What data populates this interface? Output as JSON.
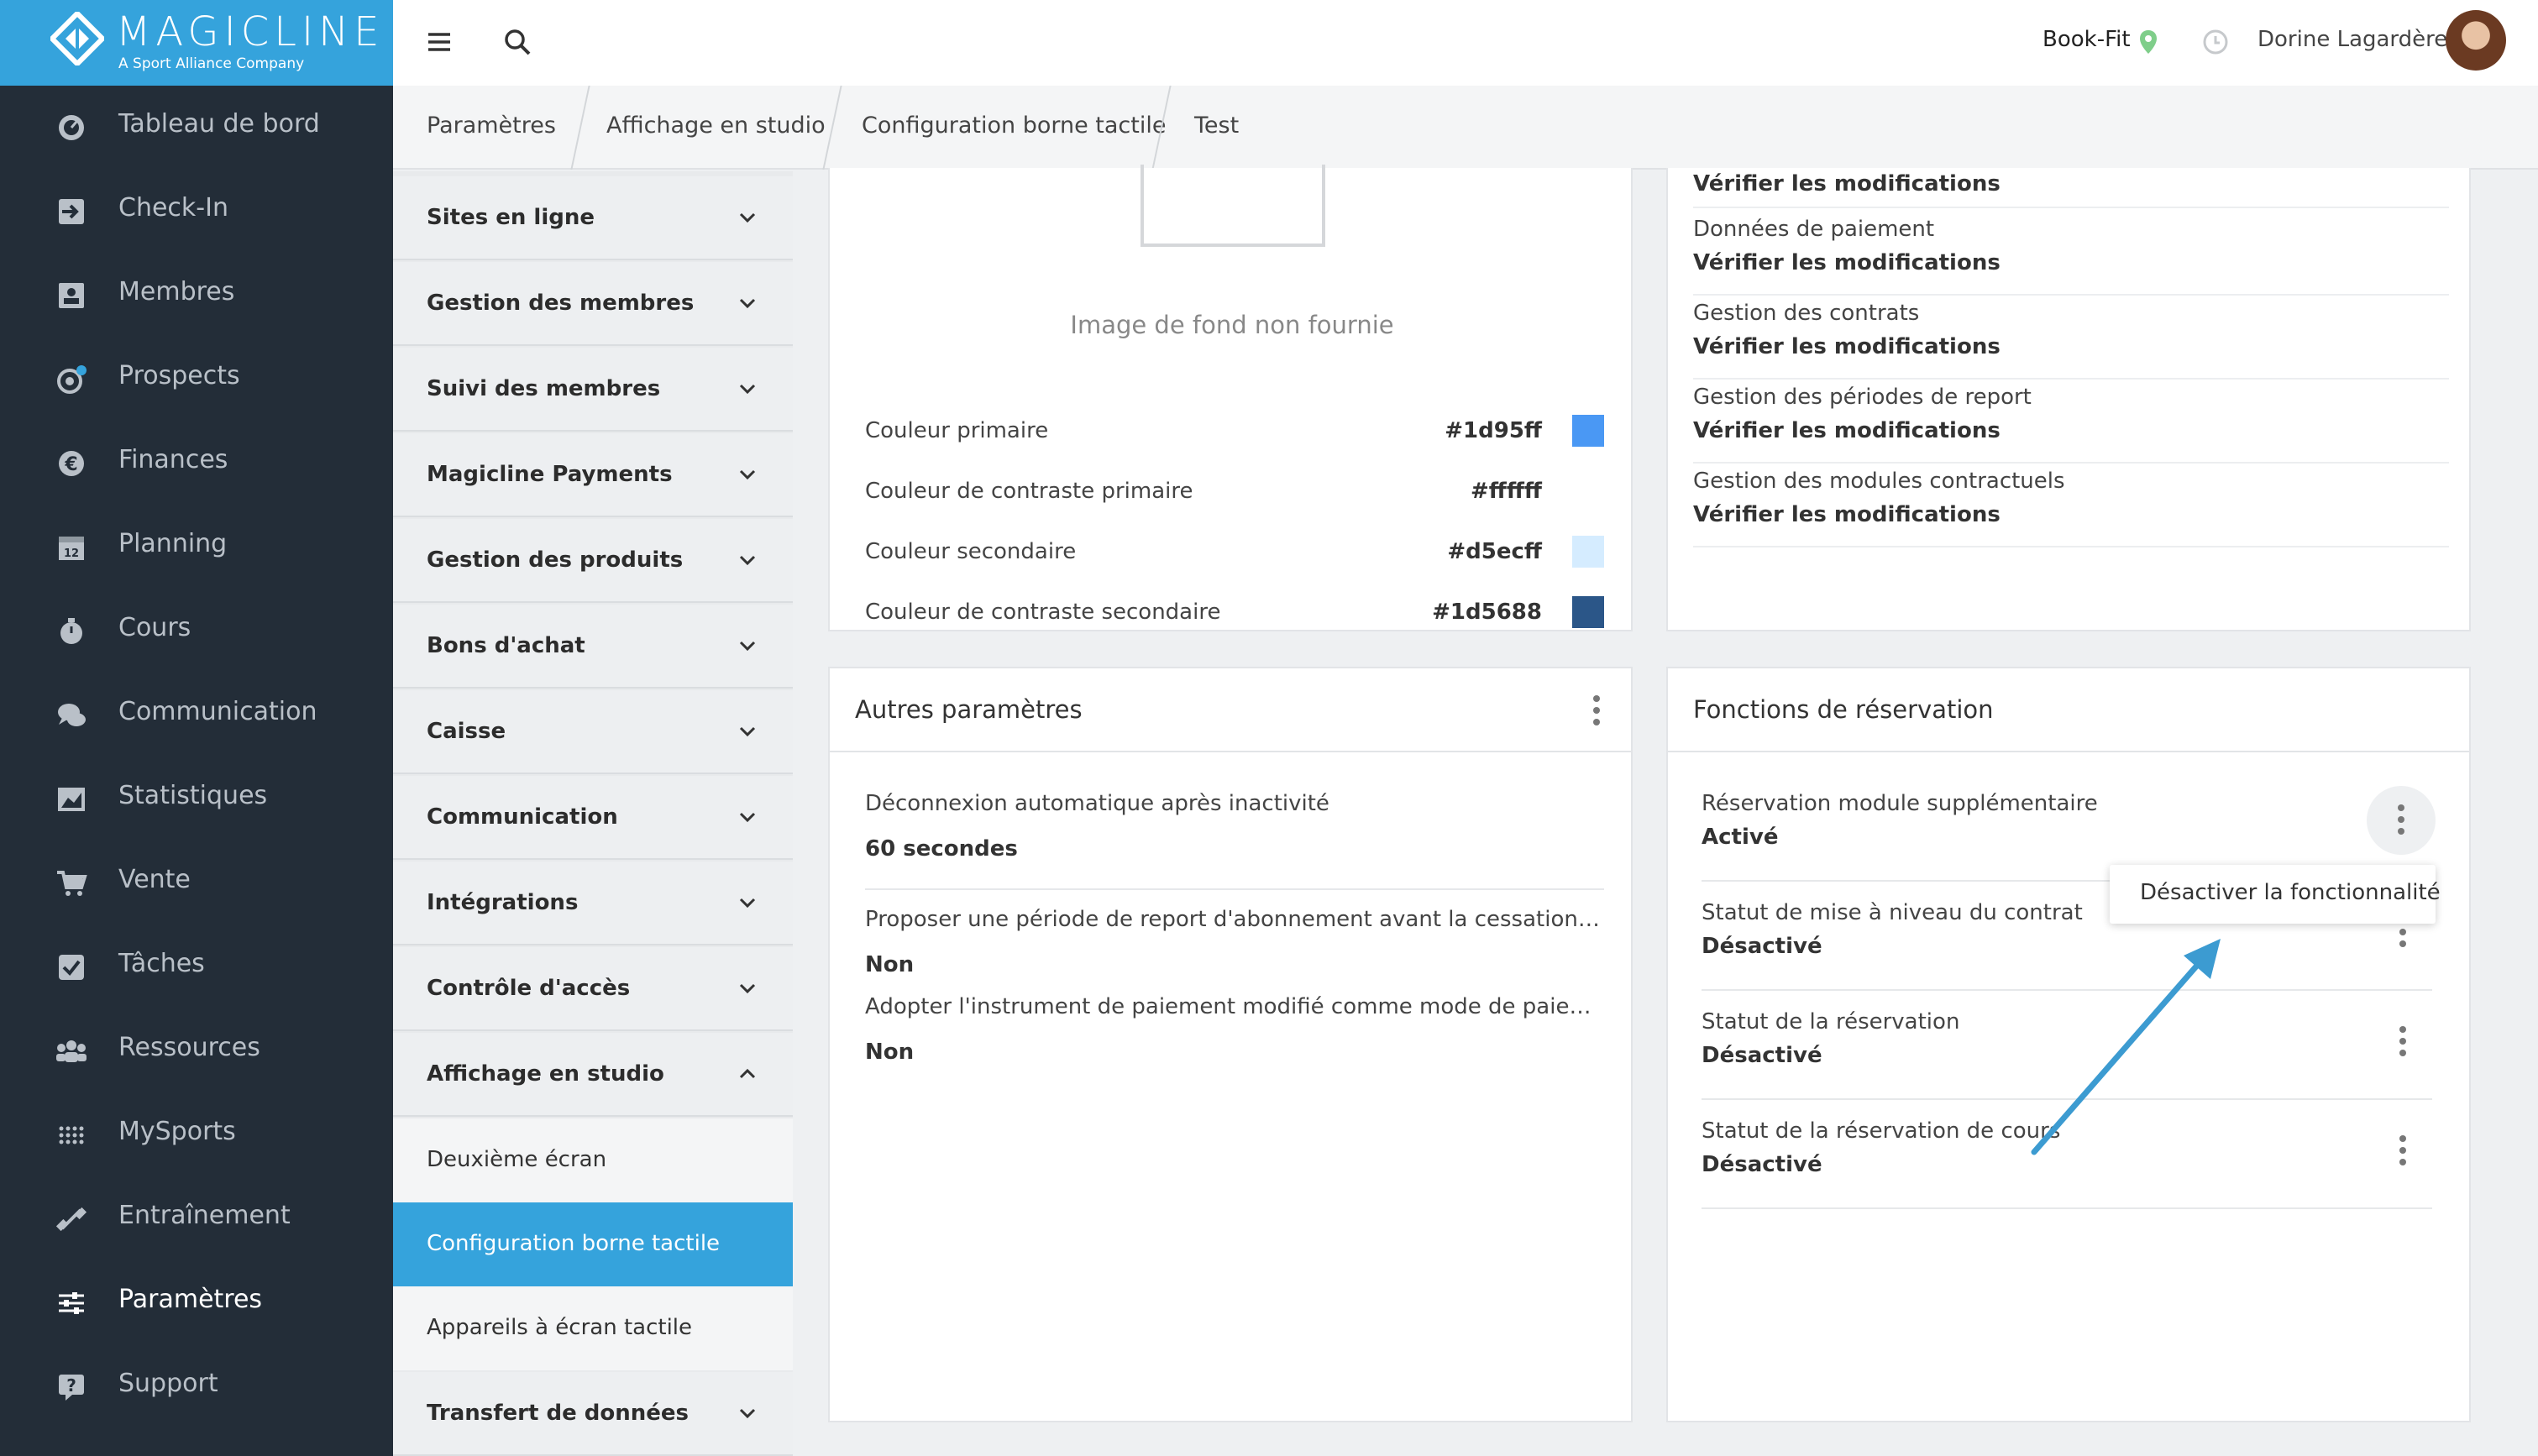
{
  "brand": {
    "name": "MAGICLINE",
    "tagline": "A Sport Alliance Company"
  },
  "nav": [
    {
      "label": "Tableau de bord",
      "icon": "dashboard-icon"
    },
    {
      "label": "Check-In",
      "icon": "check-in-icon"
    },
    {
      "label": "Membres",
      "icon": "members-icon"
    },
    {
      "label": "Prospects",
      "icon": "prospects-icon"
    },
    {
      "label": "Finances",
      "icon": "euro-icon"
    },
    {
      "label": "Planning",
      "icon": "calendar-icon"
    },
    {
      "label": "Cours",
      "icon": "stopwatch-icon"
    },
    {
      "label": "Communication",
      "icon": "chat-icon"
    },
    {
      "label": "Statistiques",
      "icon": "chart-icon"
    },
    {
      "label": "Vente",
      "icon": "cart-icon"
    },
    {
      "label": "Tâches",
      "icon": "checkbox-icon"
    },
    {
      "label": "Ressources",
      "icon": "people-icon"
    },
    {
      "label": "MySports",
      "icon": "dots-grid-icon"
    },
    {
      "label": "Entraînement",
      "icon": "dumbbell-icon"
    },
    {
      "label": "Paramètres",
      "icon": "sliders-icon"
    },
    {
      "label": "Support",
      "icon": "help-icon"
    }
  ],
  "topbar": {
    "studio": "Book-Fit",
    "user": "Dorine Lagardère"
  },
  "breadcrumb": [
    "Paramètres",
    "Affichage en studio",
    "Configuration borne tactile",
    "Test"
  ],
  "submenu": {
    "sections": [
      "Sites en ligne",
      "Gestion des membres",
      "Suivi des membres",
      "Magicline Payments",
      "Gestion des produits",
      "Bons d'achat",
      "Caisse",
      "Communication",
      "Intégrations",
      "Contrôle d'accès",
      "Affichage en studio"
    ],
    "children": [
      "Deuxième écran",
      "Configuration borne tactile",
      "Appareils à écran tactile"
    ],
    "last": "Transfert de données"
  },
  "colors": {
    "image_missing": "Image de fond non fournie",
    "rows": [
      {
        "name": "Couleur primaire",
        "hex": "#1d95ff",
        "swatch": "#4a98f4"
      },
      {
        "name": "Couleur de contraste primaire",
        "hex": "#ffffff",
        "swatch": "#ffffff"
      },
      {
        "name": "Couleur secondaire",
        "hex": "#d5ecff",
        "swatch": "#d5ecff"
      },
      {
        "name": "Couleur de contraste secondaire",
        "hex": "#1d5688",
        "swatch": "#2b5688"
      }
    ]
  },
  "verify": {
    "top_value": "Vérifier les modifications",
    "rows": [
      {
        "name": "Données de paiement",
        "value": "Vérifier les modifications"
      },
      {
        "name": "Gestion des contrats",
        "value": "Vérifier les modifications"
      },
      {
        "name": "Gestion des périodes de report",
        "value": "Vérifier les modifications"
      },
      {
        "name": "Gestion des modules contractuels",
        "value": "Vérifier les modifications"
      }
    ]
  },
  "other": {
    "title": "Autres paramètres",
    "rows": [
      {
        "name": "Déconnexion automatique après inactivité",
        "value": "60 secondes"
      },
      {
        "name": "Proposer une période de report d'abonnement avant la cessation d'activité",
        "value": "Non"
      },
      {
        "name": "Adopter l'instrument de paiement modifié comme mode de paiement du…",
        "value": "Non"
      }
    ]
  },
  "booking": {
    "title": "Fonctions de réservation",
    "rows": [
      {
        "name": "Réservation module supplémentaire",
        "value": "Activé"
      },
      {
        "name": "Statut de mise à niveau du contrat",
        "value": "Désactivé"
      },
      {
        "name": "Statut de la réservation",
        "value": "Désactivé"
      },
      {
        "name": "Statut de la réservation de cours",
        "value": "Désactivé"
      }
    ],
    "menu_action": "Désactiver la fonctionnalité"
  },
  "accent": "#35a3dc"
}
